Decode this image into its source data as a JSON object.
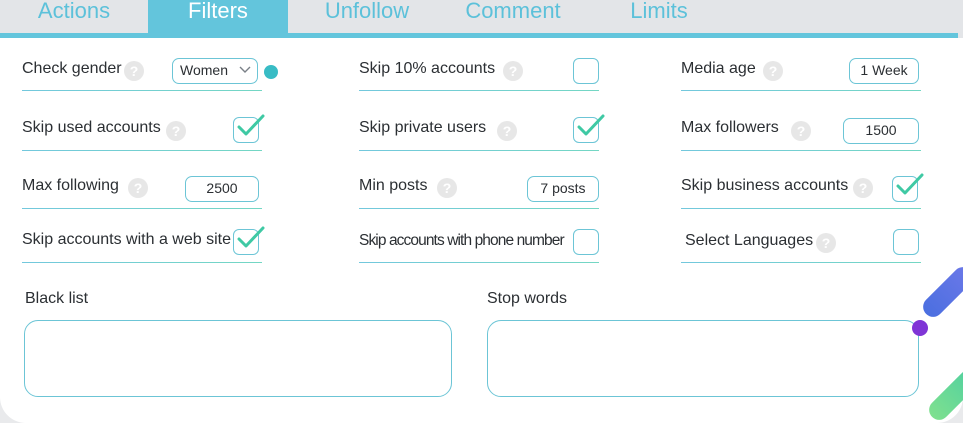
{
  "tabs": [
    {
      "label": "Actions",
      "active": false
    },
    {
      "label": "Filters",
      "active": true
    },
    {
      "label": "Unfollow",
      "active": false
    },
    {
      "label": "Comment",
      "active": false
    },
    {
      "label": "Limits",
      "active": false
    }
  ],
  "filters": {
    "check_gender": {
      "label": "Check gender",
      "value": "Women"
    },
    "skip_10_accounts": {
      "label": "Skip 10% accounts",
      "checked": false
    },
    "media_age": {
      "label": "Media age",
      "value": "1 Week"
    },
    "skip_used_accounts": {
      "label": "Skip used accounts",
      "checked": true
    },
    "skip_private_users": {
      "label": "Skip private users",
      "checked": true
    },
    "max_followers": {
      "label": "Max followers",
      "value": "1500"
    },
    "max_following": {
      "label": "Max following",
      "value": "2500"
    },
    "min_posts": {
      "label": "Min posts",
      "value": "7 posts"
    },
    "skip_business_accounts": {
      "label": "Skip business accounts",
      "checked": true
    },
    "skip_web_site": {
      "label": "Skip accounts with a web site",
      "checked": true
    },
    "skip_phone_number": {
      "label": "Skip accounts with phone number",
      "checked": false
    },
    "select_languages": {
      "label": "Select Languages",
      "checked": false
    }
  },
  "help_glyph": "?",
  "black_list": {
    "label": "Black list",
    "value": ""
  },
  "stop_words": {
    "label": "Stop words",
    "value": ""
  },
  "colors": {
    "accent": "#63c5dc",
    "check": "#3fc9a4",
    "tab_bg": "#e3e5e8"
  },
  "icons": {
    "help": "question-circle-icon",
    "check": "checkmark-icon",
    "dropdown": "chevron-down-icon"
  }
}
